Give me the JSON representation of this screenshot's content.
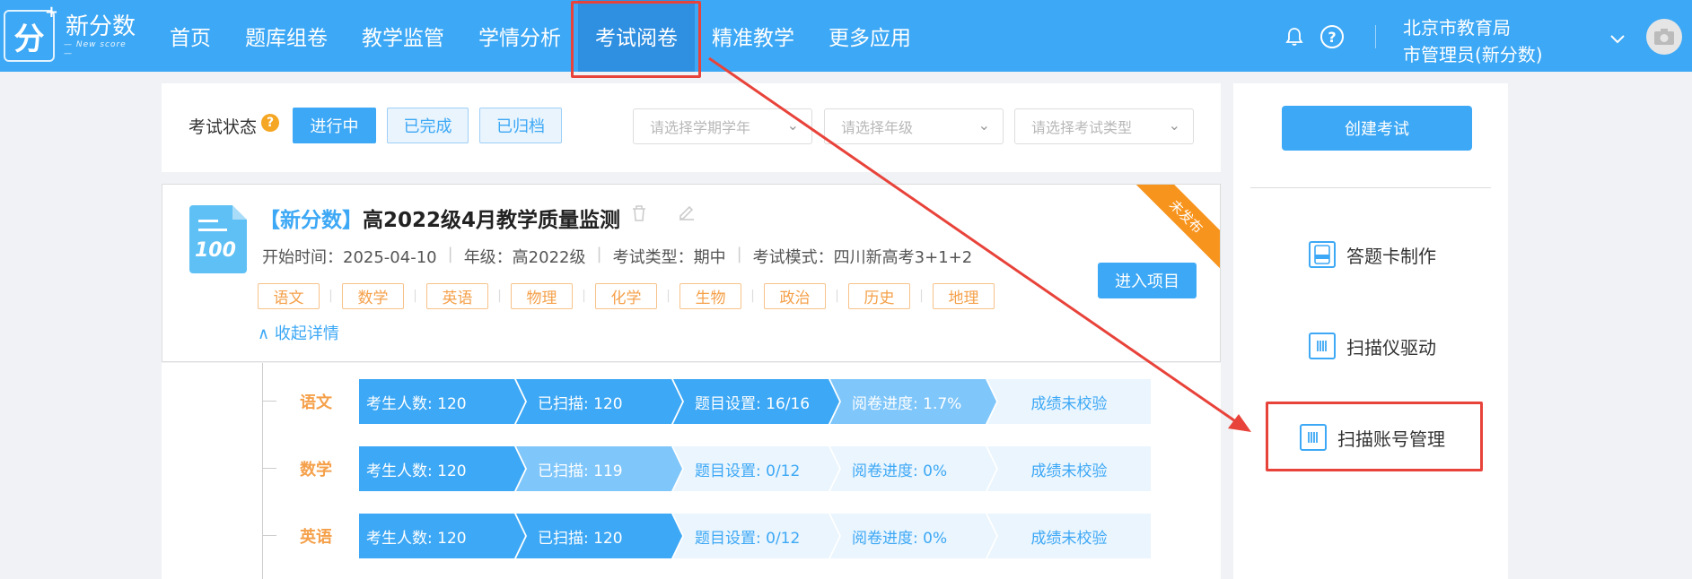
{
  "header": {
    "logo_text": "新分数",
    "logo_sub": "— New score —",
    "logo_mark": "分",
    "nav": [
      {
        "label": "首页"
      },
      {
        "label": "题库组卷"
      },
      {
        "label": "教学监管"
      },
      {
        "label": "学情分析"
      },
      {
        "label": "考试阅卷",
        "active": true
      },
      {
        "label": "精准教学"
      },
      {
        "label": "更多应用"
      }
    ],
    "org": "北京市教育局",
    "role": "市管理员(新分数)"
  },
  "filter": {
    "status_label": "考试状态",
    "status_buttons": [
      "进行中",
      "已完成",
      "已归档"
    ],
    "selects": [
      "请选择学期学年",
      "请选择年级",
      "请选择考试类型"
    ]
  },
  "exam": {
    "title_brand": "【新分数】",
    "title": "高2022级4月教学质量监测",
    "start_time": "开始时间：2025-04-10",
    "grade": "年级：高2022级",
    "type": "考试类型：期中",
    "mode": "考试模式：四川新高考3+1+2",
    "subjects": [
      "语文",
      "数学",
      "英语",
      "物理",
      "化学",
      "生物",
      "政治",
      "历史",
      "地理"
    ],
    "collapse_label": "收起详情",
    "enter_label": "进入项目",
    "ribbon": "未发布",
    "doc_num": "100"
  },
  "rows": [
    {
      "name": "语文",
      "students": "考生人数: 120",
      "scanned": "已扫描: 120",
      "questions": "题目设置: 16/16",
      "progress": "阅卷进度: 1.7%",
      "verify": "成绩未校验"
    },
    {
      "name": "数学",
      "students": "考生人数: 120",
      "scanned": "已扫描: 119",
      "questions": "题目设置: 0/12",
      "progress": "阅卷进度: 0%",
      "verify": "成绩未校验"
    },
    {
      "name": "英语",
      "students": "考生人数: 120",
      "scanned": "已扫描: 120",
      "questions": "题目设置: 0/12",
      "progress": "阅卷进度: 0%",
      "verify": "成绩未校验"
    }
  ],
  "right_panel": {
    "create_label": "创建考试",
    "items": [
      "答题卡制作",
      "扫描仪驱动",
      "扫描账号管理"
    ]
  },
  "colors": {
    "primary": "#3da8f5",
    "accent_orange": "#f5a04a",
    "highlight_red": "#e8433a"
  }
}
